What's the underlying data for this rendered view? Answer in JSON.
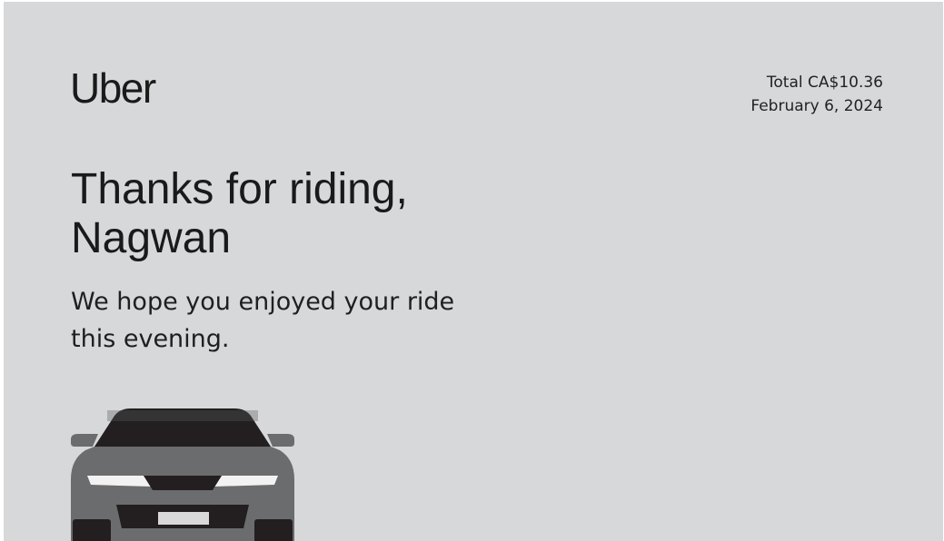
{
  "brand": {
    "logo_text": "Uber"
  },
  "receipt": {
    "total": "Total CA$10.36",
    "date": "February 6, 2024"
  },
  "message": {
    "headline_line1": "Thanks for riding,",
    "headline_line2": "Nagwan",
    "body_line1": "We hope you enjoyed your ride",
    "body_line2": "this evening."
  },
  "colors": {
    "background": "#d7d8da",
    "text": "#1a1a1a",
    "car_body": "#6b6c6e",
    "car_dark": "#231f20"
  },
  "illustration": {
    "icon": "car-front-icon"
  }
}
